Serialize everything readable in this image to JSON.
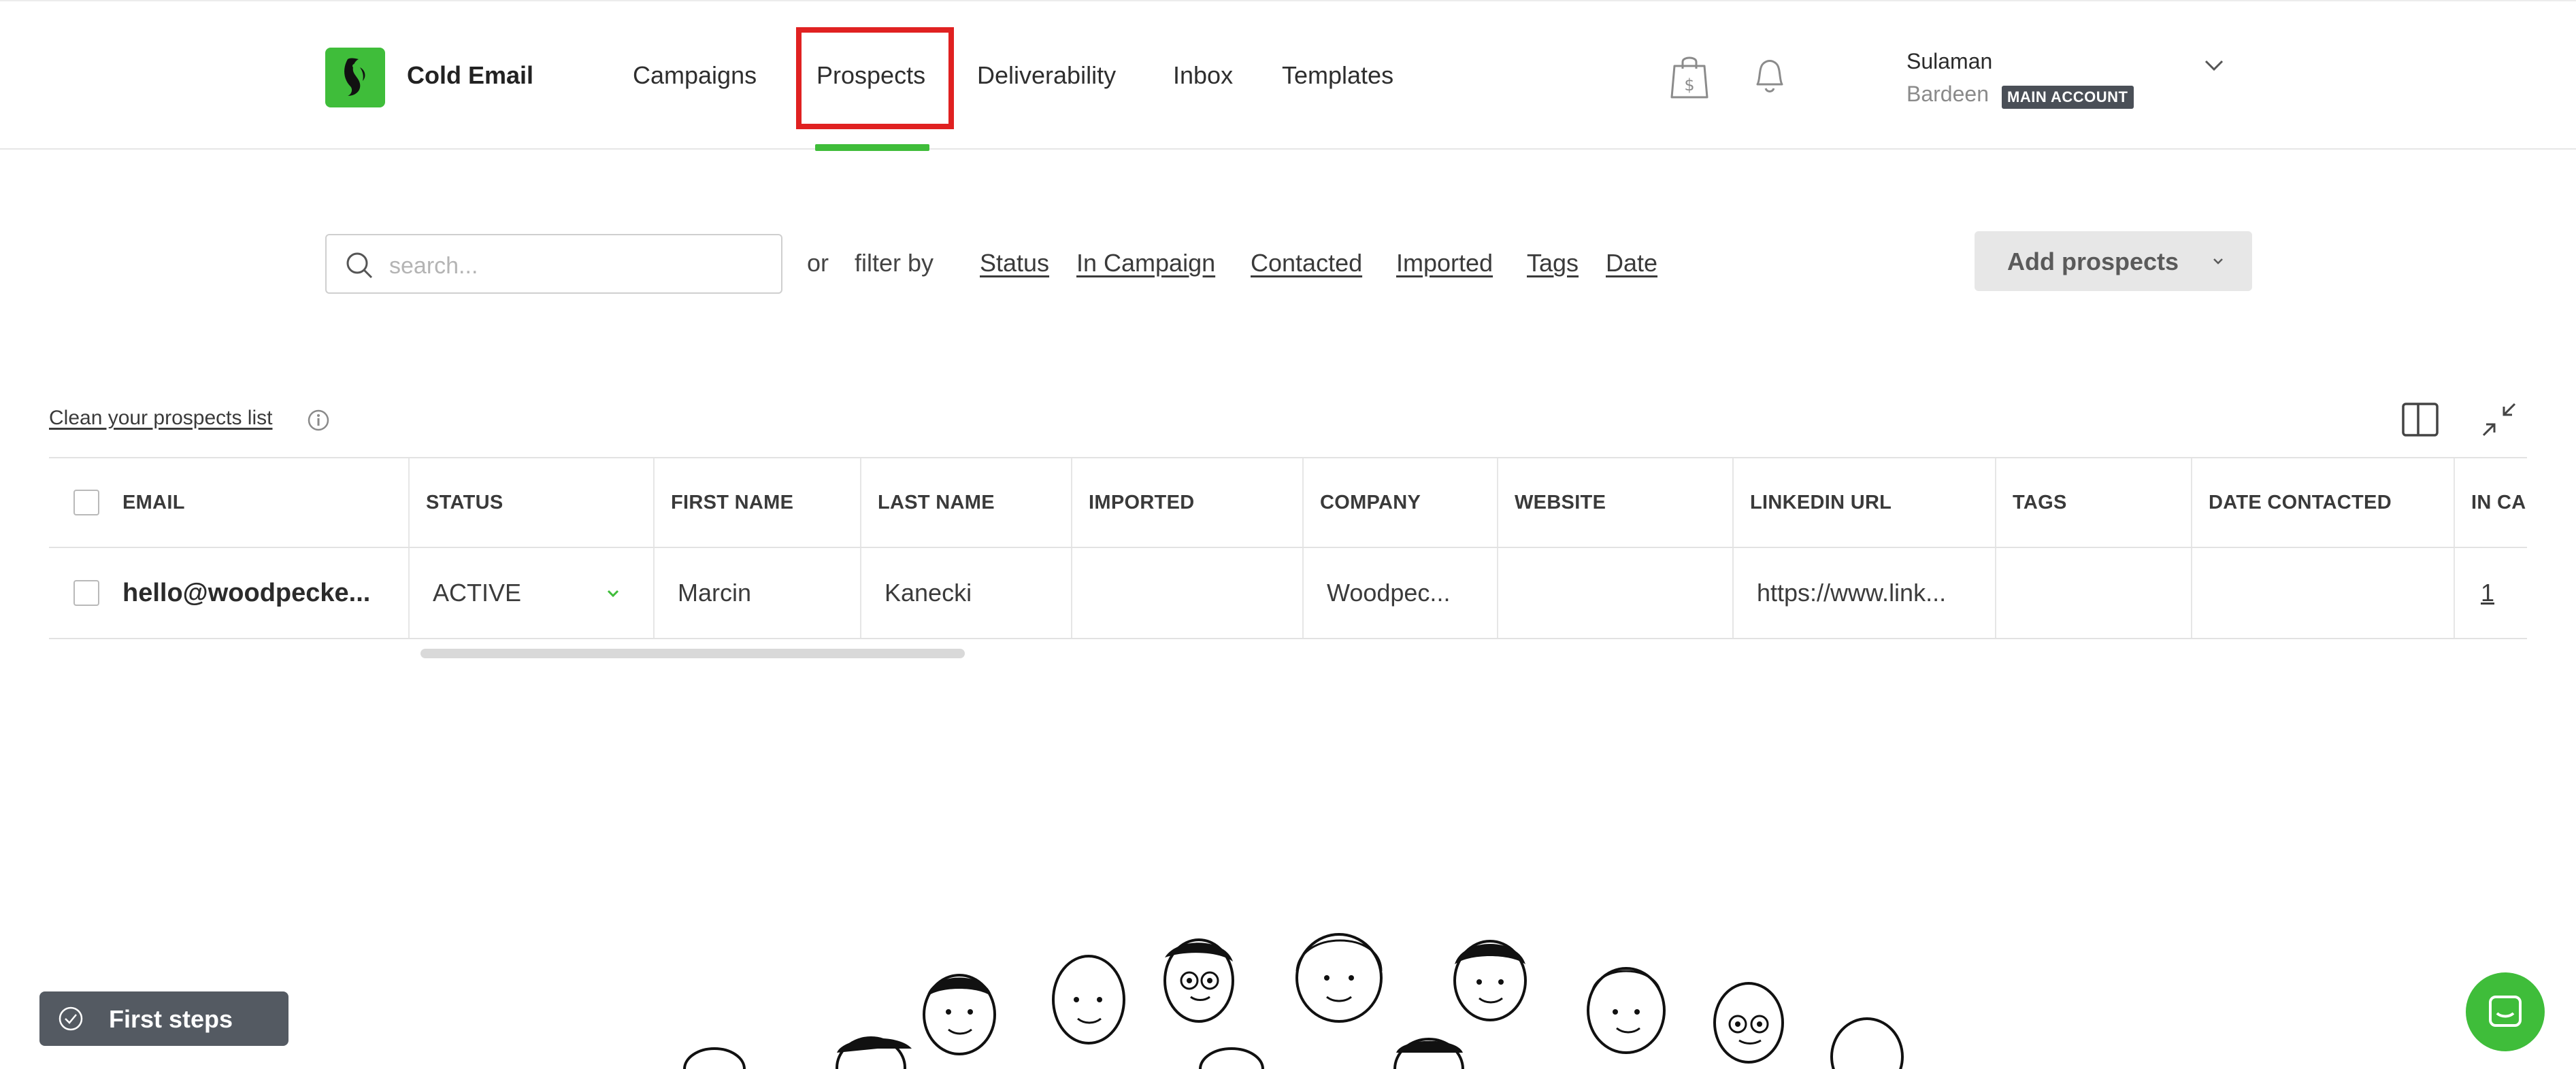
{
  "header": {
    "app_name": "Cold Email",
    "logo_icon": "woodpecker-logo-icon",
    "nav": [
      {
        "label": "Campaigns",
        "active": false
      },
      {
        "label": "Prospects",
        "active": true
      },
      {
        "label": "Deliverability",
        "active": false
      },
      {
        "label": "Inbox",
        "active": false
      },
      {
        "label": "Templates",
        "active": false
      }
    ],
    "icons": [
      "shopping-bag-dollar-icon",
      "bell-icon"
    ],
    "user": {
      "name": "Sulaman",
      "account": "Bardeen",
      "badge": "MAIN ACCOUNT"
    },
    "accent_color": "#3fbd3a",
    "highlight_color": "#e02121"
  },
  "filter_bar": {
    "search_placeholder": "search...",
    "or_text": "or",
    "filter_by_text": "filter by",
    "filters": [
      "Status",
      "In Campaign",
      "Contacted",
      "Imported",
      "Tags",
      "Date"
    ],
    "add_button": "Add prospects"
  },
  "toolbar": {
    "clean_link": "Clean your prospects list",
    "icons": [
      "info-icon",
      "column-layout-icon",
      "collapse-icon"
    ]
  },
  "table": {
    "columns": [
      "EMAIL",
      "STATUS",
      "FIRST NAME",
      "LAST NAME",
      "IMPORTED",
      "COMPANY",
      "WEBSITE",
      "LINKEDIN URL",
      "TAGS",
      "DATE CONTACTED",
      "IN CAI"
    ],
    "rows": [
      {
        "email": "hello@woodpecke...",
        "status": "ACTIVE",
        "first_name": "Marcin",
        "last_name": "Kanecki",
        "imported": "",
        "company": "Woodpec...",
        "website": "",
        "linkedin_url": "https://www.link...",
        "tags": "",
        "date_contacted": "",
        "in_campaign": "1"
      }
    ]
  },
  "bottom": {
    "first_steps": "First steps",
    "chat_icon": "chat-bubble-icon",
    "illustration": "faces-illustration"
  }
}
